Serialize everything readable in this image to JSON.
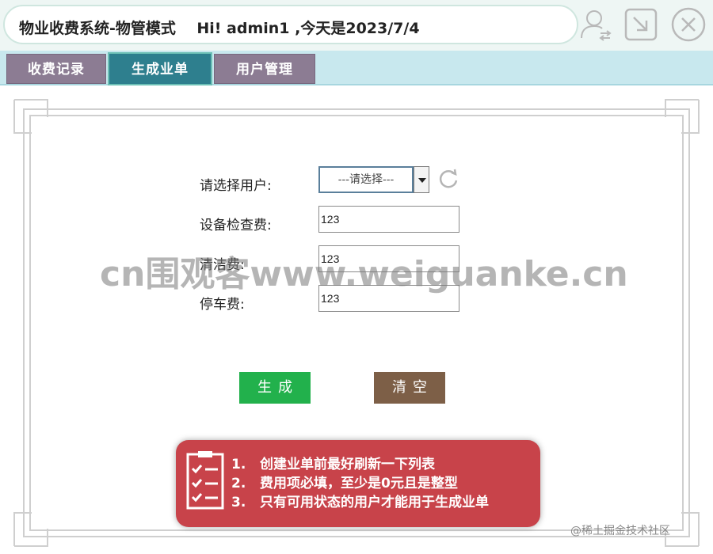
{
  "header": {
    "title": "物业收费系统-物管模式    Hi! admin1 ,今天是2023/7/4",
    "icons": [
      "user-switch-icon",
      "minimize-icon",
      "close-icon"
    ]
  },
  "tabs": [
    {
      "label": "收费记录",
      "active": false
    },
    {
      "label": "生成业单",
      "active": true
    },
    {
      "label": "用户管理",
      "active": false
    }
  ],
  "form": {
    "user_label": "请选择用户:",
    "user_select_value": "---请选择---",
    "inspection_fee_label": "设备检查费:",
    "inspection_fee_value": "123",
    "cleaning_fee_label": "清洁费:",
    "cleaning_fee_value": "123",
    "parking_fee_label": "停车费:",
    "parking_fee_value": "123"
  },
  "buttons": {
    "generate_label": "生成",
    "clear_label": "清空"
  },
  "notice": {
    "lines": [
      "1.   创建业单前最好刷新一下列表",
      "2.   费用项必填，至少是0元且是整型",
      "3.   只有可用状态的用户才能用于生成业单"
    ]
  },
  "watermark": "cn围观客www.weiguanke.cn",
  "credit": "@稀土掘金技术社区",
  "colors": {
    "tab_active": "#2e7f8e",
    "tab_inactive": "#8c7c93",
    "generate_button": "#22b14c",
    "clear_button": "#7d5f47",
    "notice_bg": "#c8434a"
  }
}
